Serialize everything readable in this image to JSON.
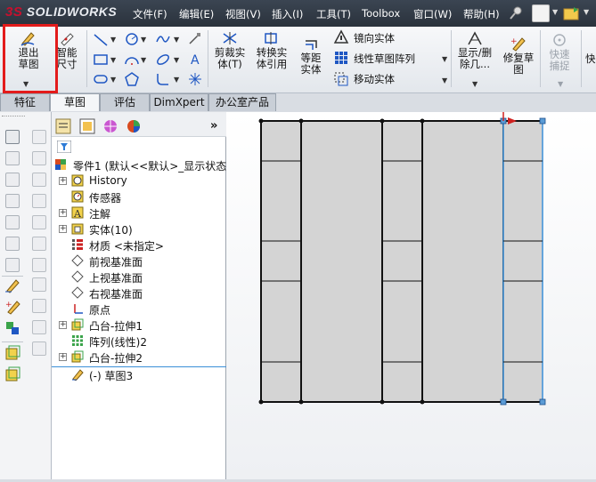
{
  "app": {
    "logo": "SOLIDWORKS",
    "logo_prefix": "3S"
  },
  "menu": [
    "文件(F)",
    "编辑(E)",
    "视图(V)",
    "插入(I)",
    "工具(T)",
    "Toolbox",
    "窗口(W)",
    "帮助(H)"
  ],
  "ribbon": {
    "exit_sketch": "退出草图",
    "smart_dim": "智能尺寸",
    "trim": "剪裁实体(T)",
    "convert": "转换实体引用",
    "offset": "等距实体",
    "mirror": "镜向实体",
    "linear_pattern": "线性草图阵列",
    "move": "移动实体",
    "show_delete": "显示/删除几...",
    "repair": "修复草图",
    "quick_snap": "快速捕捉",
    "quick_view": "快"
  },
  "tabs": [
    "特征",
    "草图",
    "评估",
    "DimXpert",
    "办公室产品"
  ],
  "tree": {
    "root": "零件1  (默认<<默认>_显示状态",
    "items": [
      {
        "label": "History",
        "expandable": true
      },
      {
        "label": "传感器",
        "expandable": false
      },
      {
        "label": "注解",
        "expandable": true
      },
      {
        "label": "实体(10)",
        "expandable": true
      },
      {
        "label": "材质 <未指定>",
        "expandable": false
      },
      {
        "label": "前视基准面",
        "expandable": false
      },
      {
        "label": "上视基准面",
        "expandable": false
      },
      {
        "label": "右视基准面",
        "expandable": false
      },
      {
        "label": "原点",
        "expandable": false
      },
      {
        "label": "凸台-拉伸1",
        "expandable": true
      },
      {
        "label": "阵列(线性)2",
        "expandable": false
      },
      {
        "label": "凸台-拉伸2",
        "expandable": true
      },
      {
        "label": "(-) 草图3",
        "expandable": false
      }
    ]
  },
  "colors": {
    "highlight": "#e31b1b",
    "selection": "#3b8fd8",
    "solid_fill": "#d4d4d4"
  }
}
